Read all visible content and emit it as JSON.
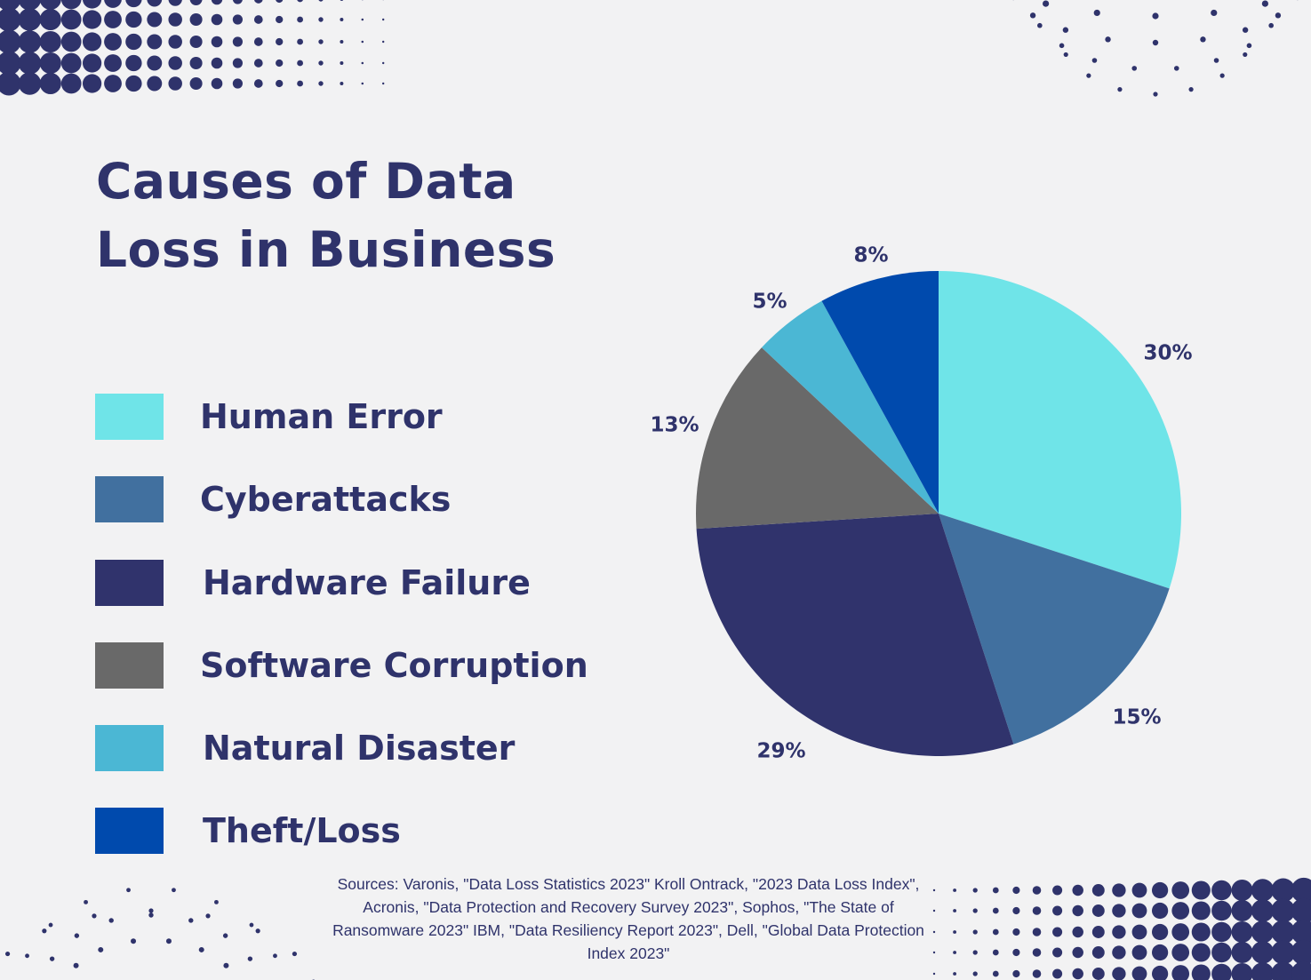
{
  "title": "Causes of Data Loss in Business",
  "title_lines": [
    "Causes of Data",
    "Loss in Business"
  ],
  "colors": {
    "background": "#f2f2f3",
    "text": "#2f336b",
    "decor_dots": "#2f336b"
  },
  "sources": "Sources: Varonis, \"Data Loss Statistics 2023\" Kroll Ontrack, \"2023 Data Loss Index\", Acronis, \"Data Protection and Recovery Survey 2023\", Sophos, \"The State of Ransomware 2023\" IBM, \"Data Resiliency Report 2023\", Dell, \"Global Data Protection Index 2023\"",
  "chart_data": {
    "type": "pie",
    "title": "Causes of Data Loss in Business",
    "start": "12 o'clock",
    "direction": "clockwise",
    "legend_position": "left",
    "slices": [
      {
        "label": "Human Error",
        "value": 30,
        "display": "30%",
        "color": "#6fe4e8"
      },
      {
        "label": "Cyberattacks",
        "value": 15,
        "display": "15%",
        "color": "#41709f"
      },
      {
        "label": "Hardware Failure",
        "value": 29,
        "display": "29%",
        "color": "#30336c"
      },
      {
        "label": "Software Corruption",
        "value": 13,
        "display": "13%",
        "color": "#696969"
      },
      {
        "label": "Natural Disaster",
        "value": 5,
        "display": "5%",
        "color": "#4bb7d4"
      },
      {
        "label": "Theft/Loss",
        "value": 8,
        "display": "8%",
        "color": "#004aad"
      }
    ]
  }
}
